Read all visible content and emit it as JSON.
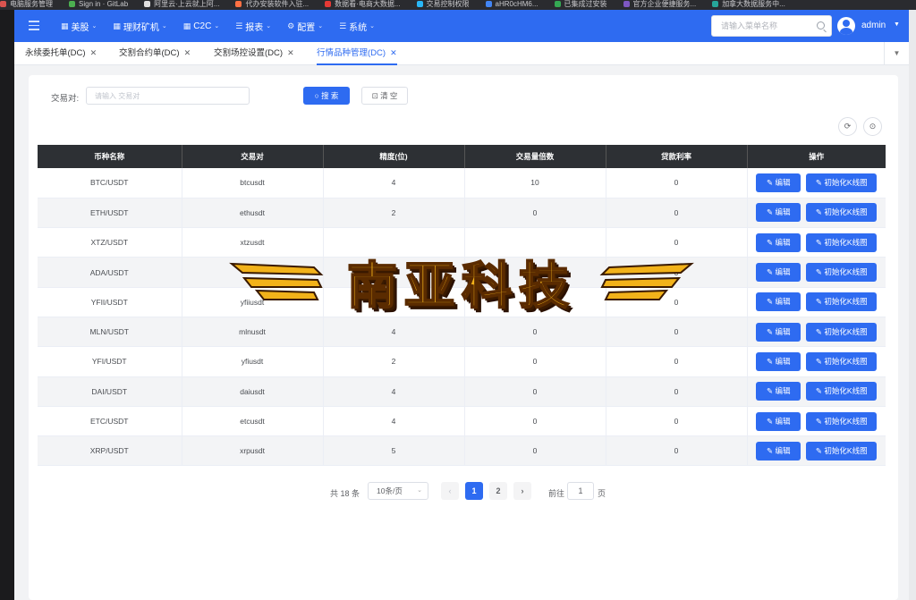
{
  "browser": {
    "bookmarks": [
      "电脑服务管理",
      "Sign in · GitLab",
      "阿里云·上云就上阿...",
      "代办安装软件入驻...",
      "数据看·电商大数据...",
      "交易控制权限",
      "aHR0cHM6...",
      "已集成过安装",
      "官方企业便捷服务...",
      "加拿大数据服务中..."
    ],
    "bookmark_colors": [
      "#d9534f",
      "#4caf50",
      "#e0e0e0",
      "#ff7043",
      "#e53935",
      "#29b6f6",
      "#4285f4",
      "#34a853",
      "#7e57c2",
      "#26a69a"
    ]
  },
  "header": {
    "menu_icon": "hamburger-icon",
    "nav": [
      {
        "icon": "▦",
        "label": "美股"
      },
      {
        "icon": "▦",
        "label": "理财矿机"
      },
      {
        "icon": "▦",
        "label": "C2C"
      },
      {
        "icon": "☰",
        "label": "报表"
      },
      {
        "icon": "⚙",
        "label": "配置"
      },
      {
        "icon": "☰",
        "label": "系统"
      }
    ],
    "search_placeholder": "请输入菜单名称",
    "username": "admin"
  },
  "tabs": [
    {
      "label": "永续委托单(DC)",
      "active": false
    },
    {
      "label": "交割合约单(DC)",
      "active": false
    },
    {
      "label": "交割场控设置(DC)",
      "active": false
    },
    {
      "label": "行情品种管理(DC)",
      "active": true
    }
  ],
  "filter": {
    "label": "交易对:",
    "placeholder": "请输入 交易对",
    "search_btn": "搜 索",
    "reset_btn": "清 空",
    "search_icon": "○",
    "reset_icon": "⊡"
  },
  "toolbar": {
    "refresh_icon": "⟳",
    "search_icon": "⊙"
  },
  "table": {
    "headers": [
      "币种名称",
      "交易对",
      "精度(位)",
      "交易量倍数",
      "贷款利率",
      "操作"
    ],
    "edit_label": "✎ 编辑",
    "kline_label": "✎ 初始化K线图",
    "rows": [
      [
        "BTC/USDT",
        "btcusdt",
        "4",
        "10",
        "0"
      ],
      [
        "ETH/USDT",
        "ethusdt",
        "2",
        "0",
        "0"
      ],
      [
        "XTZ/USDT",
        "xtzusdt",
        "",
        "",
        "0"
      ],
      [
        "ADA/USDT",
        "",
        "",
        "",
        "0"
      ],
      [
        "YFII/USDT",
        "yfiiusdt",
        "",
        "",
        "0"
      ],
      [
        "MLN/USDT",
        "mlnusdt",
        "4",
        "0",
        "0"
      ],
      [
        "YFI/USDT",
        "yfiusdt",
        "2",
        "0",
        "0"
      ],
      [
        "DAI/USDT",
        "daiusdt",
        "4",
        "0",
        "0"
      ],
      [
        "ETC/USDT",
        "etcusdt",
        "4",
        "0",
        "0"
      ],
      [
        "XRP/USDT",
        "xrpusdt",
        "5",
        "0",
        "0"
      ]
    ]
  },
  "pagination": {
    "total": "共 18 条",
    "page_size": "10条/页",
    "prev": "‹",
    "pages": [
      "1",
      "2"
    ],
    "next": "›",
    "goto_label": "前往",
    "goto_value": "1",
    "page_unit": "页"
  },
  "watermark": {
    "text": "南亚科技"
  },
  "colors": {
    "primary": "#2e6bf1",
    "header_table": "#2d3034"
  }
}
